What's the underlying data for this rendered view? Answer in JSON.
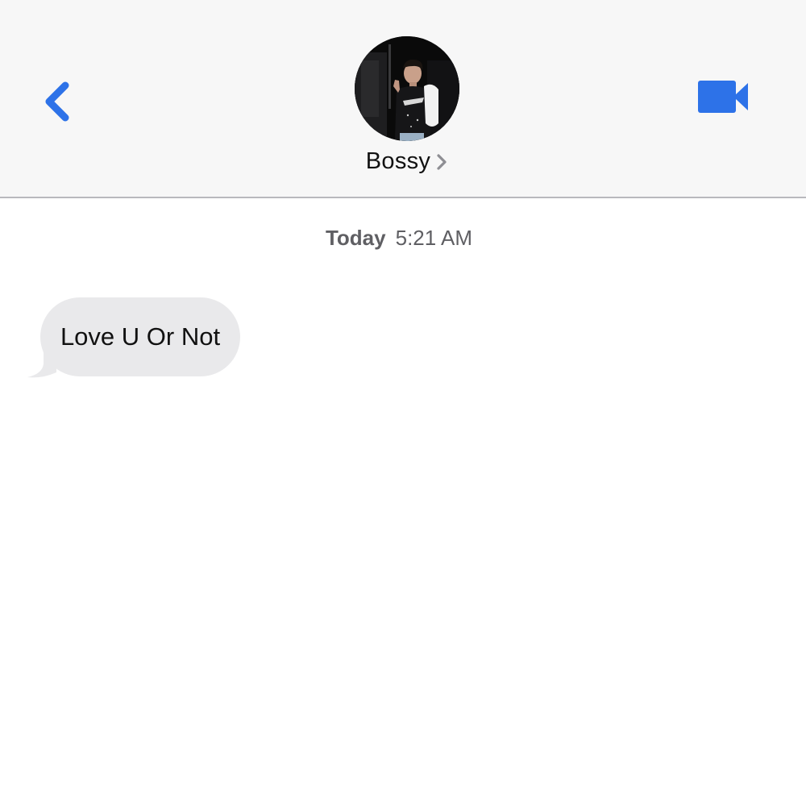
{
  "header": {
    "contact_name": "Bossy",
    "back_icon": "chevron-left-icon",
    "video_icon": "video-camera-icon",
    "name_chevron_icon": "chevron-right-icon",
    "accent_color": "#2d72e8"
  },
  "conversation": {
    "timestamp_day": "Today",
    "timestamp_time": "5:21 AM",
    "messages": [
      {
        "direction": "incoming",
        "text": "Love U Or Not"
      }
    ]
  }
}
